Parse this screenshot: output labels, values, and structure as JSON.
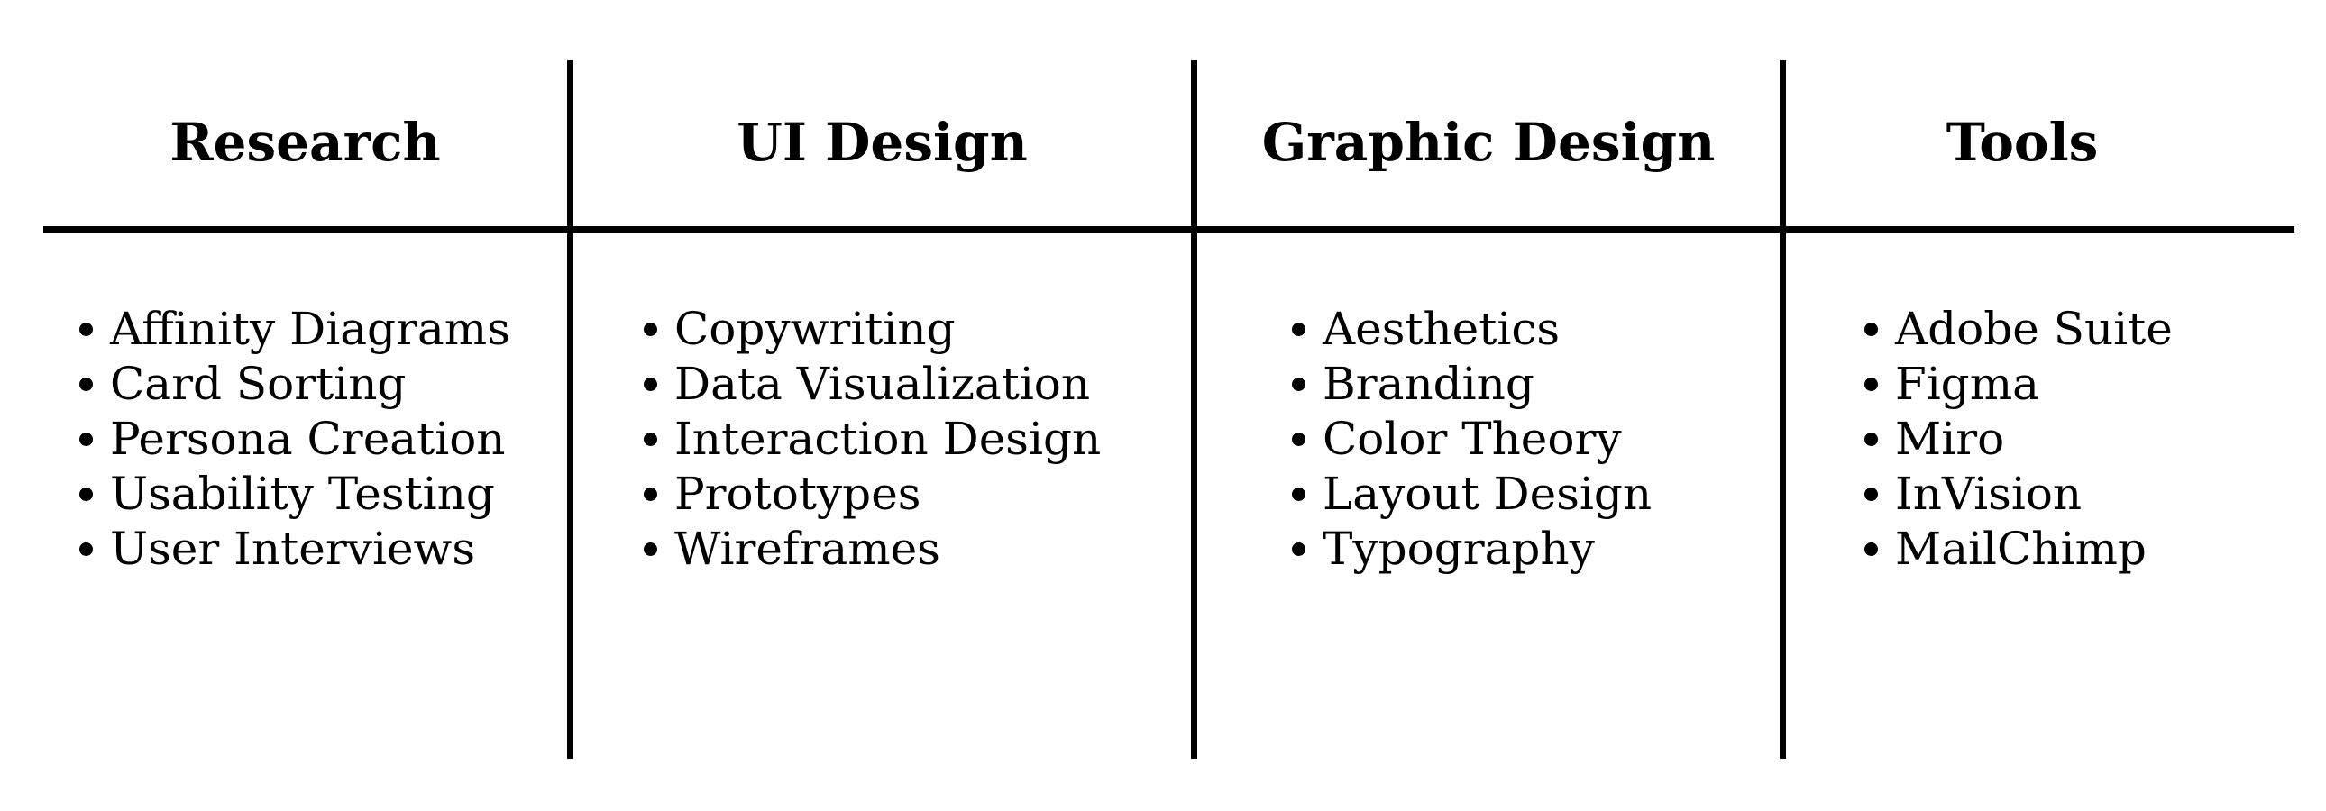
{
  "columns": [
    {
      "header": "Research",
      "items": [
        "Affinity Diagrams",
        "Card Sorting",
        "Persona Creation",
        "Usability Testing",
        "User Interviews"
      ]
    },
    {
      "header": "UI Design",
      "items": [
        "Copywriting",
        "Data Visualization",
        "Interaction Design",
        "Prototypes",
        "Wireframes"
      ]
    },
    {
      "header": "Graphic Design",
      "items": [
        "Aesthetics",
        "Branding",
        "Color Theory",
        "Layout Design",
        "Typography"
      ]
    },
    {
      "header": "Tools",
      "items": [
        "Adobe Suite",
        "Figma",
        "Miro",
        "InVision",
        "MailChimp"
      ]
    }
  ],
  "colors": {
    "text": "#000000",
    "rule": "#000000",
    "background": "#ffffff"
  }
}
